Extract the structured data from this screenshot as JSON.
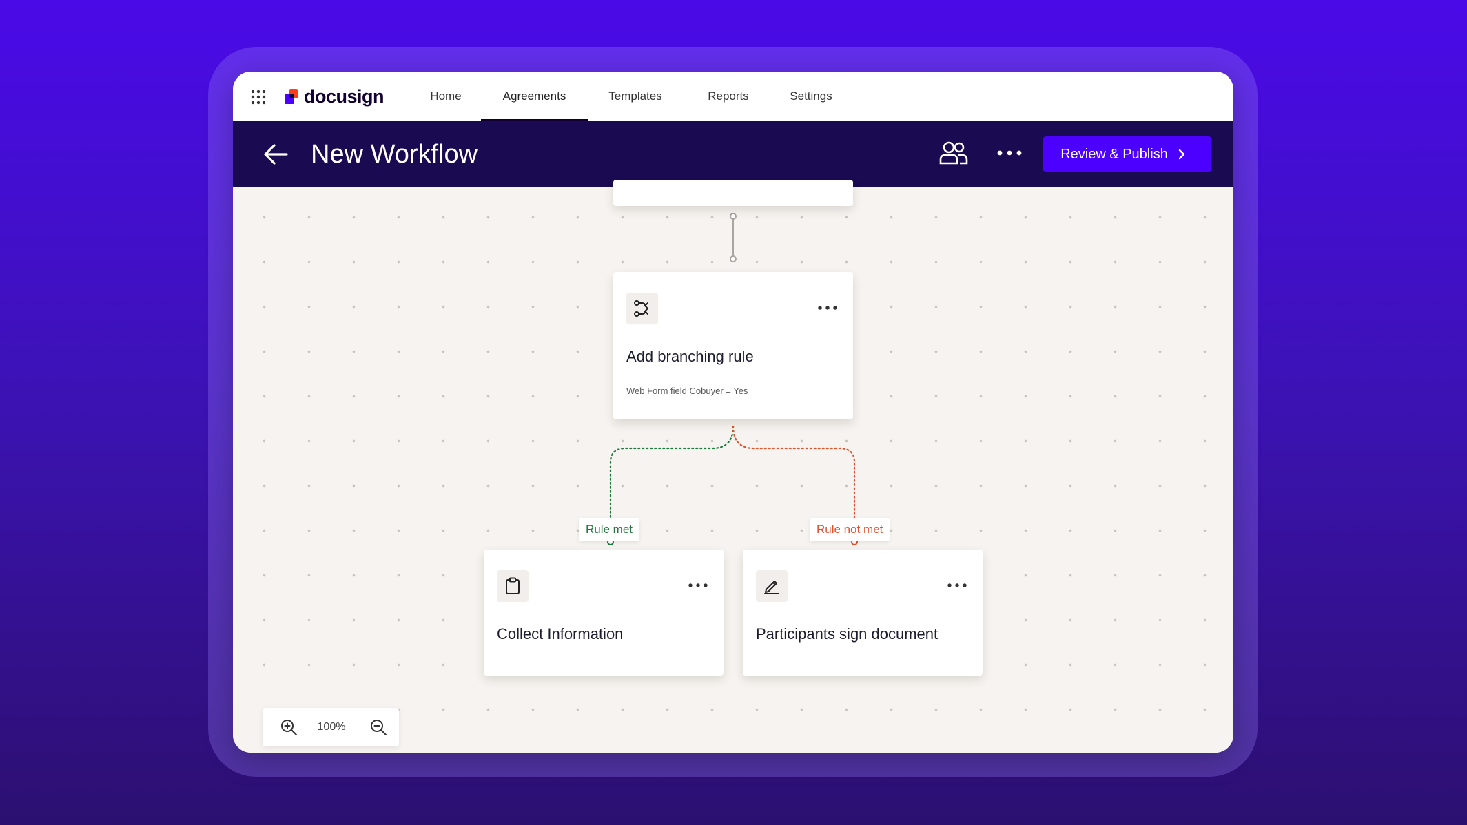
{
  "app": {
    "brand": "docusign",
    "brand_colors": {
      "mark_primary": "#ff3c1e",
      "mark_secondary": "#4c00ff",
      "text": "#130032"
    }
  },
  "nav": {
    "items": [
      {
        "label": "Home",
        "active": false
      },
      {
        "label": "Agreements",
        "active": true
      },
      {
        "label": "Templates",
        "active": false
      },
      {
        "label": "Reports",
        "active": false
      },
      {
        "label": "Settings",
        "active": false
      }
    ]
  },
  "header": {
    "title": "New Workflow",
    "publish_label": "Review & Publish",
    "icons": [
      "back-arrow-icon",
      "people-icon",
      "more-icon",
      "chevron-right-icon"
    ]
  },
  "workflow": {
    "branch_card": {
      "title": "Add branching rule",
      "condition": "Web Form field  Cobuyer = Yes",
      "icon": "branch-icon"
    },
    "labels": {
      "met": "Rule met",
      "not_met": "Rule not met"
    },
    "collect_card": {
      "title": "Collect Information",
      "icon": "clipboard-icon"
    },
    "sign_card": {
      "title": "Participants sign document",
      "icon": "pen-icon"
    }
  },
  "zoom": {
    "level": "100%"
  },
  "colors": {
    "header_bg": "#190a52",
    "accent": "#4c00ff",
    "rule_met": "#1e7a3c",
    "rule_not_met": "#e0532a",
    "canvas_bg": "#f6f3f0"
  }
}
